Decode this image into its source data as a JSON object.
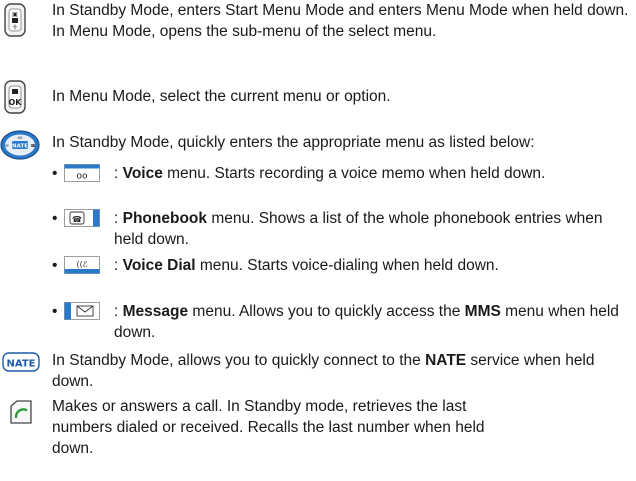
{
  "entries": [
    {
      "icon": "menu-key-icon",
      "text": "In Standby Mode, enters Start Menu Mode and enters Menu Mode when held down. In Menu Mode, opens the sub-menu of the select menu."
    },
    {
      "icon": "ok-key-icon",
      "text": "In Menu Mode, select the current menu or option."
    },
    {
      "icon": "navigation-key-icon",
      "text": "In Standby Mode, quickly enters the appropriate menu as listed below:"
    }
  ],
  "shortcuts": [
    {
      "icon": "voicemail-key-icon",
      "sep": ": ",
      "name": "Voice",
      "desc": " menu. Starts recording a voice memo when held down."
    },
    {
      "icon": "phonebook-key-icon",
      "sep": ": ",
      "name": "Phonebook",
      "desc": " menu. Shows a list of the whole phonebook entries when held down."
    },
    {
      "icon": "voice-dial-key-icon",
      "sep": ": ",
      "name": "Voice Dial",
      "desc": " menu. Starts voice-dialing when held down."
    },
    {
      "icon": "message-key-icon",
      "sep": ": ",
      "name": "Message",
      "desc": " menu. Allows you to quickly access the ",
      "bold2": "MMS",
      "desc2": " menu when held down."
    }
  ],
  "nate": {
    "icon": "nate-key-icon",
    "pre": "In Standby Mode, allows you to quickly connect to the ",
    "bold": "NATE",
    "post": " service when held down."
  },
  "send": {
    "icon": "send-key-icon",
    "text": "Makes or answers a call. In Standby mode, retrieves the last numbers dialed or received. Recalls the last number when held down."
  },
  "colors": {
    "key_blue": "#2a78c8",
    "key_border": "#555555",
    "call_green": "#2a9a3a",
    "nate_blue": "#1e5aa8"
  }
}
